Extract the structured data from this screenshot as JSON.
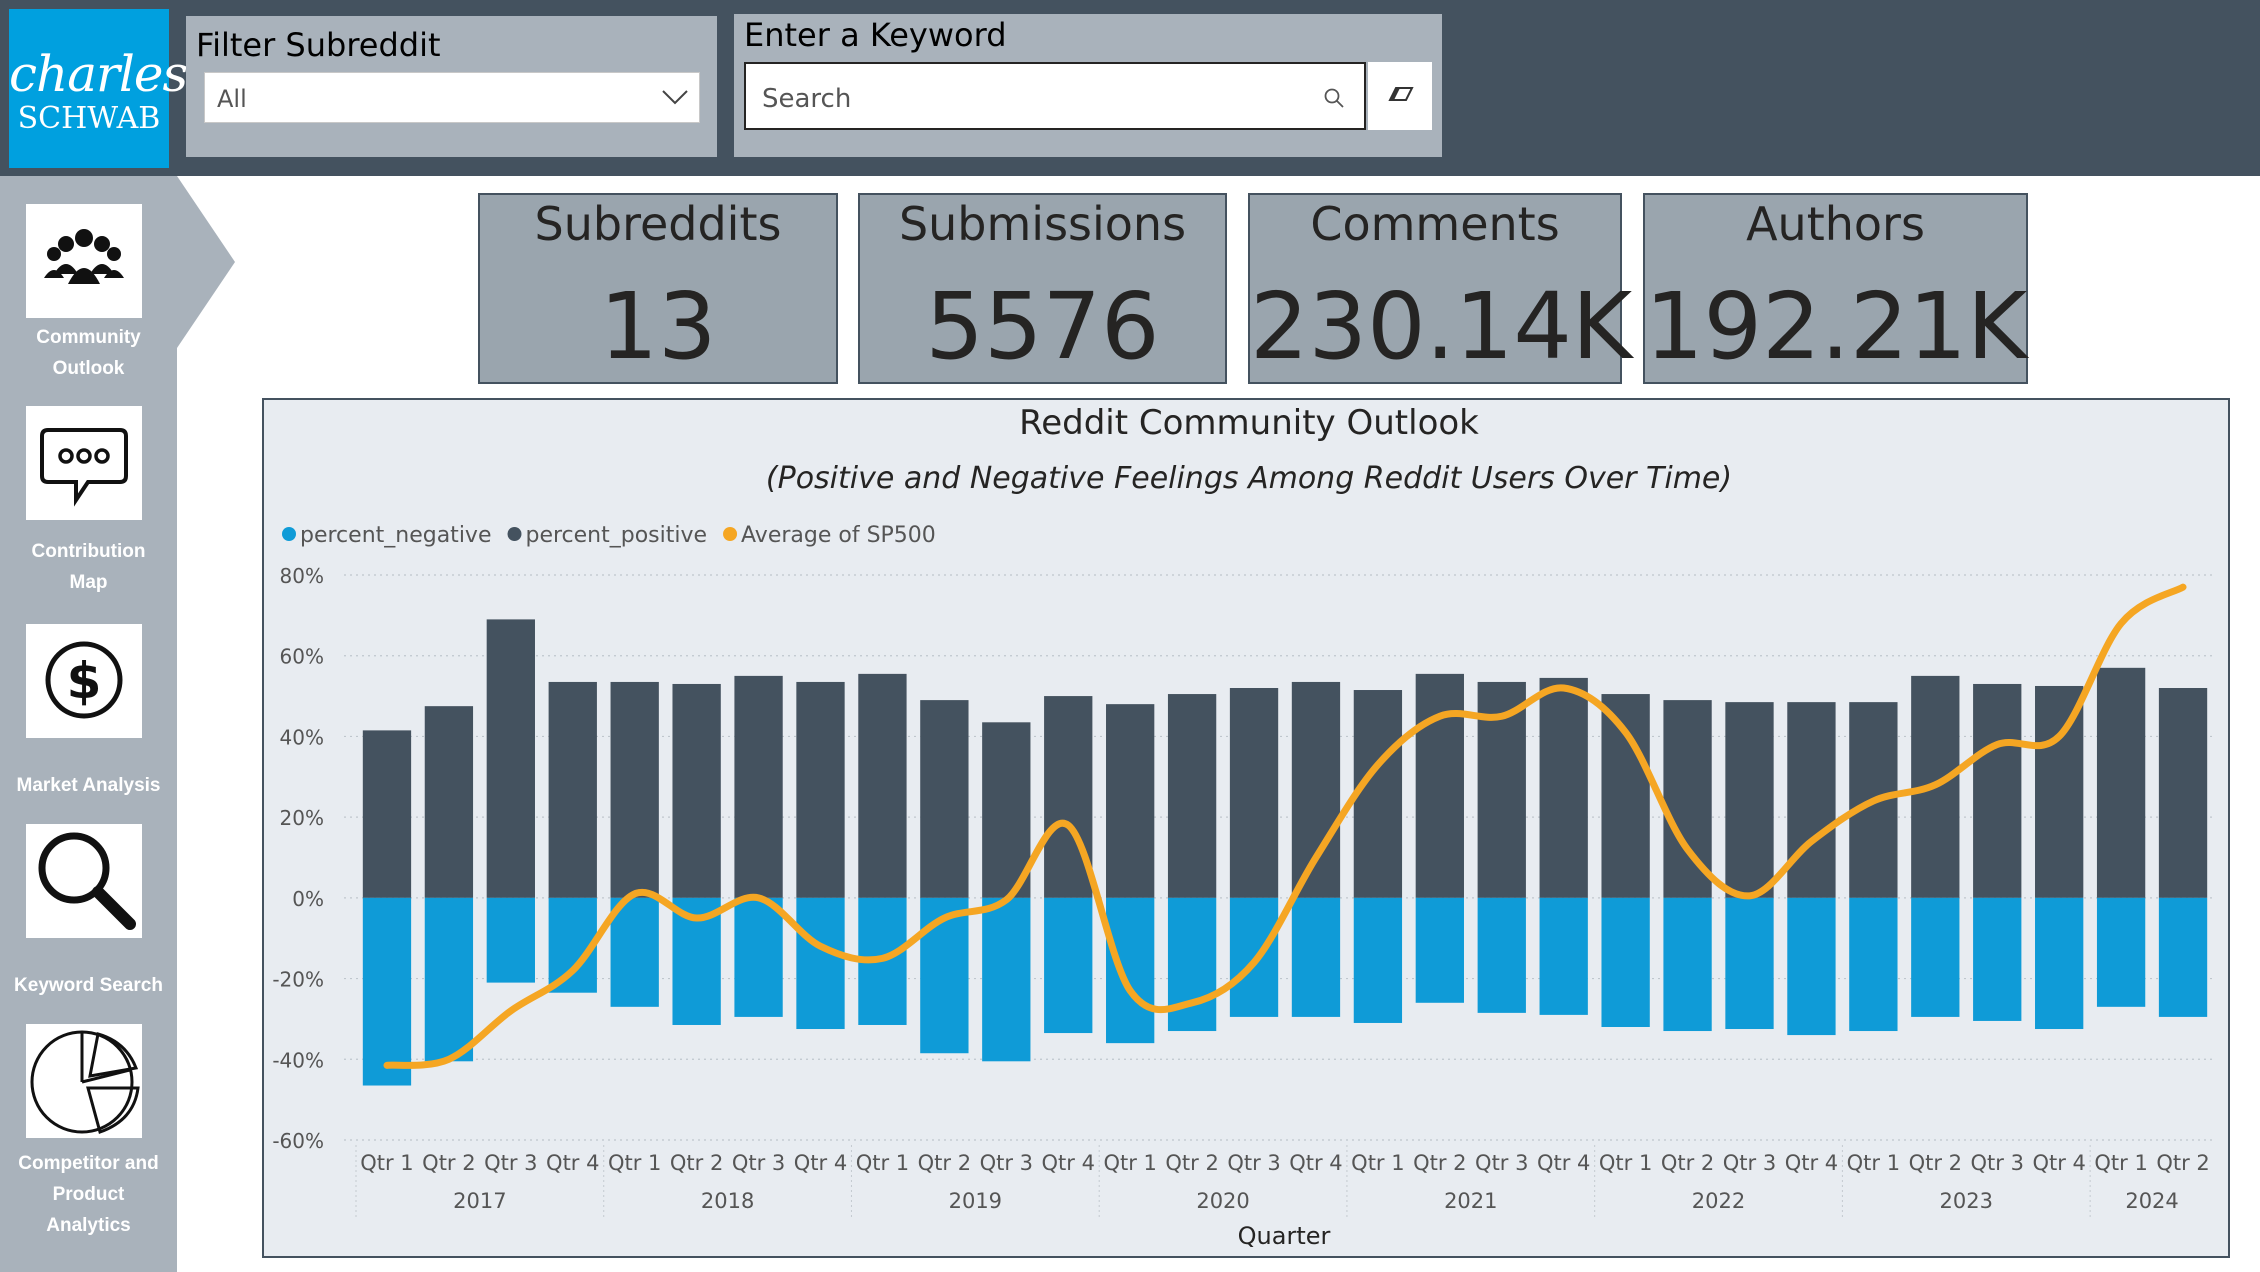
{
  "brand": {
    "line1": "charles",
    "line2": "SCHWAB"
  },
  "filter": {
    "title": "Filter Subreddit",
    "selected": "All"
  },
  "keyword": {
    "title": "Enter a Keyword",
    "placeholder": "Search"
  },
  "nav": [
    {
      "label": "Community Outlook",
      "icon": "people-group-icon"
    },
    {
      "label": "Contribution Map",
      "icon": "speech-bubble-icon"
    },
    {
      "label": "Market Analysis",
      "icon": "dollar-icon"
    },
    {
      "label": "Keyword Search",
      "icon": "magnifier-icon"
    },
    {
      "label": "Competitor and Product Analytics",
      "icon": "pie-chart-icon"
    }
  ],
  "kpis": [
    {
      "title": "Subreddits",
      "value": "13"
    },
    {
      "title": "Submissions",
      "value": "5576"
    },
    {
      "title": "Comments",
      "value": "230.14K"
    },
    {
      "title": "Authors",
      "value": "192.21K"
    }
  ],
  "colors": {
    "negative": "#0f9bd7",
    "positive": "#44525f",
    "sp500": "#f5a623",
    "topbar": "#44525f",
    "nav": "#a9b2bb",
    "logo": "#00a0df"
  },
  "chart_data": {
    "type": "bar",
    "title": "Reddit Community Outlook",
    "subtitle": "(Positive and Negative Feelings Among Reddit Users Over Time)",
    "xlabel": "Quarter",
    "legend_position": "top-left",
    "ylim": [
      -60,
      80
    ],
    "yticks": [
      "80%",
      "60%",
      "40%",
      "20%",
      "0%",
      "-20%",
      "-40%",
      "-60%"
    ],
    "categories": [
      "Qtr 1",
      "Qtr 2",
      "Qtr 3",
      "Qtr 4",
      "Qtr 1",
      "Qtr 2",
      "Qtr 3",
      "Qtr 4",
      "Qtr 1",
      "Qtr 2",
      "Qtr 3",
      "Qtr 4",
      "Qtr 1",
      "Qtr 2",
      "Qtr 3",
      "Qtr 4",
      "Qtr 1",
      "Qtr 2",
      "Qtr 3",
      "Qtr 4",
      "Qtr 1",
      "Qtr 2",
      "Qtr 3",
      "Qtr 4",
      "Qtr 1",
      "Qtr 2",
      "Qtr 3",
      "Qtr 4",
      "Qtr 1",
      "Qtr 2"
    ],
    "years": [
      {
        "label": "2017",
        "count": 4
      },
      {
        "label": "2018",
        "count": 4
      },
      {
        "label": "2019",
        "count": 4
      },
      {
        "label": "2020",
        "count": 4
      },
      {
        "label": "2021",
        "count": 4
      },
      {
        "label": "2022",
        "count": 4
      },
      {
        "label": "2023",
        "count": 4
      },
      {
        "label": "2024",
        "count": 2
      }
    ],
    "series": [
      {
        "name": "percent_negative",
        "values": [
          -46.5,
          -40.5,
          -21,
          -23.5,
          -27,
          -31.5,
          -29.5,
          -32.5,
          -31.5,
          -38.5,
          -40.5,
          -33.5,
          -36,
          -33,
          -29.5,
          -29.5,
          -31,
          -26,
          -28.5,
          -29,
          -32,
          -33,
          -32.5,
          -34,
          -33,
          -29.5,
          -30.5,
          -32.5,
          -27,
          -29.5
        ]
      },
      {
        "name": "percent_positive",
        "values": [
          41.5,
          47.5,
          69,
          53.5,
          53.5,
          53,
          55,
          53.5,
          55.5,
          49,
          43.5,
          50,
          48,
          50.5,
          52,
          53.5,
          51.5,
          55.5,
          53.5,
          54.5,
          50.5,
          49,
          48.5,
          48.5,
          48.5,
          55,
          53,
          52.5,
          57,
          52
        ]
      },
      {
        "name": "Average of SP500",
        "values": [
          -41.5,
          -40,
          -28,
          -18,
          1,
          -5,
          0,
          -12,
          -15,
          -5,
          -0.5,
          18,
          -23,
          -26,
          -16,
          10,
          33,
          45,
          45,
          52,
          41,
          12,
          0.5,
          14,
          24,
          28,
          38,
          40,
          68,
          77
        ]
      }
    ]
  }
}
